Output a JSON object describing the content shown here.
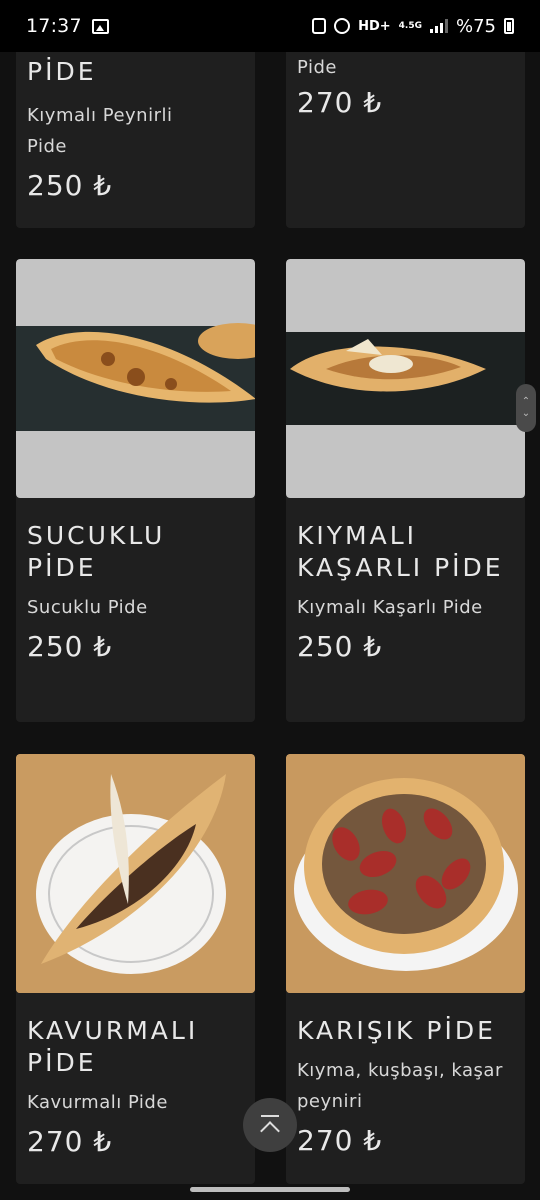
{
  "status_bar": {
    "time": "17:37",
    "hd_label": "HD+",
    "network": "4.5G",
    "battery_text": "%75"
  },
  "menu": {
    "items": [
      {
        "title": "PİDE",
        "desc": "Kıymalı Peynirli Pide",
        "price": "250 ₺"
      },
      {
        "title": "",
        "desc": "Pide",
        "price": "270 ₺"
      },
      {
        "title": "SUCUKLU PİDE",
        "desc": "Sucuklu Pide",
        "price": "250 ₺"
      },
      {
        "title": "KIYMALI KAŞARLI PİDE",
        "desc": "Kıymalı Kaşarlı Pide",
        "price": "250 ₺"
      },
      {
        "title": "KAVURMALI PİDE",
        "desc": "Kavurmalı Pide",
        "price": "270 ₺"
      },
      {
        "title": "KARIŞIK PİDE",
        "desc": "Kıyma, kuşbaşı, kaşar peyniri",
        "price": "270 ₺"
      }
    ]
  }
}
